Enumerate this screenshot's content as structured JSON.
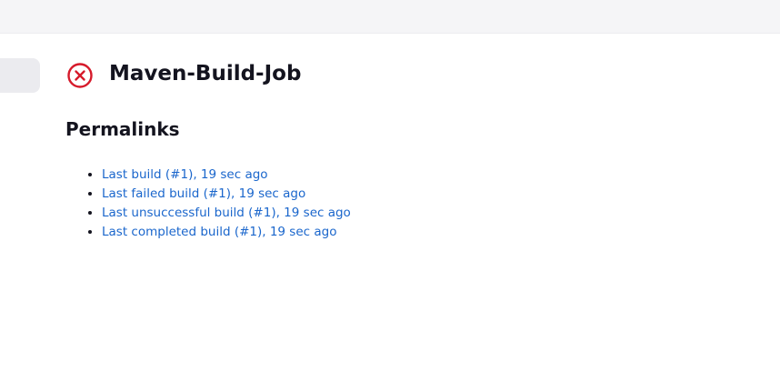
{
  "header": {
    "bar_color": "#f5f5f7"
  },
  "job": {
    "status": "failed",
    "status_icon": "failed-x-circle-icon",
    "status_color": "#d61a2b",
    "title": "Maven-Build-Job"
  },
  "permalinks": {
    "heading": "Permalinks",
    "items": [
      {
        "label": "Last build (#1), 19 sec ago"
      },
      {
        "label": "Last failed build (#1), 19 sec ago"
      },
      {
        "label": "Last unsuccessful build (#1), 19 sec ago"
      },
      {
        "label": "Last completed build (#1), 19 sec ago"
      }
    ]
  },
  "colors": {
    "link": "#1a66cc",
    "text": "#14141f"
  }
}
